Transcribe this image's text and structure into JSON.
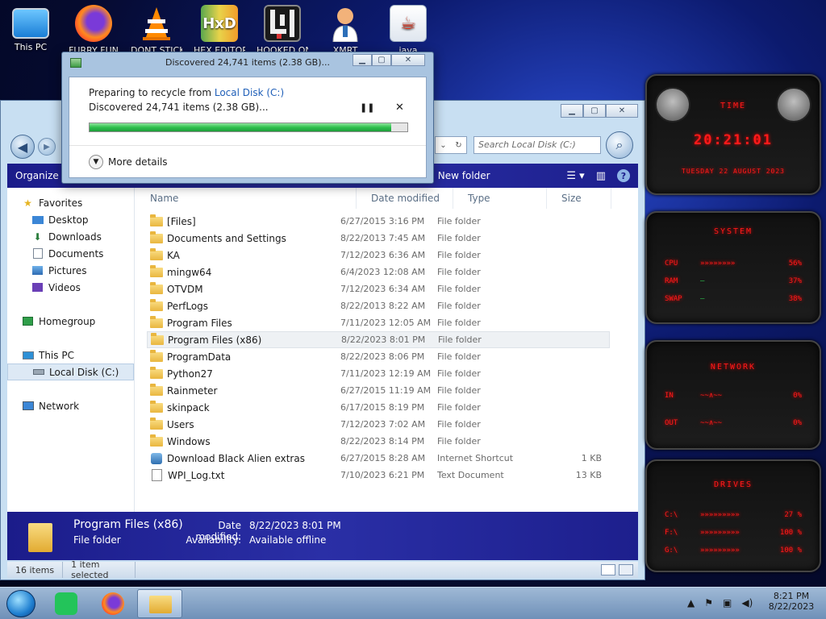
{
  "desktop": {
    "icons": [
      {
        "label": "This PC"
      },
      {
        "label": "FURRY FUN"
      },
      {
        "label": "DONT STICK"
      },
      {
        "label": "HEX EDITOR"
      },
      {
        "label": "HOOKED ON"
      },
      {
        "label": "XMRT"
      },
      {
        "label": "java"
      }
    ]
  },
  "dialog": {
    "title": "Discovered 24,741 items (2.38 GB)...",
    "preparing_prefix": "Preparing to recycle from ",
    "preparing_link": "Local Disk (C:)",
    "status": "Discovered 24,741 items (2.38 GB)...",
    "progress": 0.95,
    "pause_icon": "pause-icon",
    "cancel_icon": "close-icon",
    "more_details": "More details"
  },
  "explorer": {
    "search_placeholder": "Search Local Disk (C:)",
    "toolbar": {
      "organize": "Organize",
      "new_folder": "New folder"
    },
    "nav": {
      "favorites": "Favorites",
      "desktop": "Desktop",
      "downloads": "Downloads",
      "documents": "Documents",
      "pictures": "Pictures",
      "videos": "Videos",
      "homegroup": "Homegroup",
      "this_pc": "This PC",
      "local_disk": "Local Disk (C:)",
      "network": "Network"
    },
    "columns": {
      "name": "Name",
      "date": "Date modified",
      "type": "Type",
      "size": "Size"
    },
    "files": [
      {
        "name": "[Files]",
        "date": "6/27/2015 3:16 PM",
        "type": "File folder",
        "size": "",
        "kind": "folder"
      },
      {
        "name": "Documents and Settings",
        "date": "8/22/2013 7:45 AM",
        "type": "File folder",
        "size": "",
        "kind": "link"
      },
      {
        "name": "KA",
        "date": "7/12/2023 6:36 AM",
        "type": "File folder",
        "size": "",
        "kind": "folder"
      },
      {
        "name": "mingw64",
        "date": "6/4/2023 12:08 AM",
        "type": "File folder",
        "size": "",
        "kind": "folder"
      },
      {
        "name": "OTVDM",
        "date": "7/12/2023 6:34 AM",
        "type": "File folder",
        "size": "",
        "kind": "folder"
      },
      {
        "name": "PerfLogs",
        "date": "8/22/2013 8:22 AM",
        "type": "File folder",
        "size": "",
        "kind": "folder"
      },
      {
        "name": "Program Files",
        "date": "7/11/2023 12:05 AM",
        "type": "File folder",
        "size": "",
        "kind": "folder"
      },
      {
        "name": "Program Files (x86)",
        "date": "8/22/2023 8:01 PM",
        "type": "File folder",
        "size": "",
        "kind": "folder"
      },
      {
        "name": "ProgramData",
        "date": "8/22/2023 8:06 PM",
        "type": "File folder",
        "size": "",
        "kind": "folder"
      },
      {
        "name": "Python27",
        "date": "7/11/2023 12:19 AM",
        "type": "File folder",
        "size": "",
        "kind": "folder"
      },
      {
        "name": "Rainmeter",
        "date": "6/27/2015 11:19 AM",
        "type": "File folder",
        "size": "",
        "kind": "folder"
      },
      {
        "name": "skinpack",
        "date": "6/17/2015 8:19 PM",
        "type": "File folder",
        "size": "",
        "kind": "folder"
      },
      {
        "name": "Users",
        "date": "7/12/2023 7:02 AM",
        "type": "File folder",
        "size": "",
        "kind": "folder"
      },
      {
        "name": "Windows",
        "date": "8/22/2023 8:14 PM",
        "type": "File folder",
        "size": "",
        "kind": "folder"
      },
      {
        "name": "Download Black Alien extras",
        "date": "6/27/2015 8:28 AM",
        "type": "Internet Shortcut",
        "size": "1 KB",
        "kind": "shortcut"
      },
      {
        "name": "WPI_Log.txt",
        "date": "7/10/2023 6:21 PM",
        "type": "Text Document",
        "size": "13 KB",
        "kind": "file"
      }
    ],
    "selected_index": 7,
    "details": {
      "name": "Program Files (x86)",
      "type": "File folder",
      "date_label": "Date modified:",
      "date_value": "8/22/2023 8:01 PM",
      "avail_label": "Availability:",
      "avail_value": "Available offline"
    },
    "status": {
      "count": "16 items",
      "selected": "1 item selected"
    }
  },
  "gadget": {
    "time_title": "TIME",
    "time": "20:21:01",
    "date": "TUESDAY 22 AUGUST 2023",
    "system_title": "SYSTEM",
    "cpu_label": "CPU",
    "cpu_value": "56%",
    "ram_label": "RAM",
    "ram_value": "37%",
    "swap_label": "SWAP",
    "swap_value": "38%",
    "network_title": "NETWORK",
    "in_label": "IN",
    "in_value": "0%",
    "out_label": "OUT",
    "out_value": "0%",
    "drives_title": "DRIVES",
    "drive_c_label": "C:\\",
    "drive_c_value": "27 %",
    "drive_f_label": "F:\\",
    "drive_f_value": "100 %",
    "drive_g_label": "G:\\",
    "drive_g_value": "100 %"
  },
  "taskbar": {
    "time": "8:21 PM",
    "date": "8/22/2023"
  },
  "colors": {
    "accent_blue": "#1b1c8a",
    "progress_green": "#2ec04d",
    "gadget_red": "#ff1a1a"
  }
}
